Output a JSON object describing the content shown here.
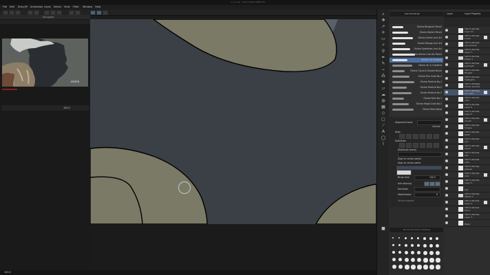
{
  "app": {
    "title": "1_C1.clip - CLIP STUDIO PAINT EX",
    "menu": [
      "File",
      "Edit",
      "Story(P)",
      "Animation",
      "Layer",
      "Select",
      "View",
      "Filter",
      "Window",
      "Help"
    ]
  },
  "left_panel": {
    "navigator_label": "Navigator",
    "zoom_value": "100.0",
    "status_zoom": "100.0"
  },
  "brush_panel": {
    "title": "Sub Tool Brush",
    "brushes": [
      "Okuha Blueprint Pencil",
      "Okuha Sketch Pencil",
      "Okuha Anime Line Art",
      "Okuha Manga Line Art",
      "Okuha Eyelashes Line Art",
      "Okuha Anime Line Art Pencil",
      "Okuha Cel Shading",
      "Okuha Air & Gradient",
      "Okuha Cloud & Smoke Brush",
      "Okuha Fine Dust No.1",
      "Okuha Particle No.1",
      "Okuha Particle No.2",
      "Okuha Particle No.3",
      "Okuha Rain No.1",
      "Okuha Magic Dust No.1",
      "Okuha Real Noise"
    ],
    "selected_index": 6
  },
  "tool_property": {
    "alignment_label": "Alignment basis",
    "alignment_value": "Canvas",
    "align_label": "Align",
    "distribute_label": "Distribute",
    "distribute_evenly": "Distribute evenly",
    "align_to_grid": "Align to vector points",
    "align_to_vector": "Align to vector paths",
    "brush_size_label": "Brush Size",
    "brush_size_value": "100.0",
    "anti_alias_label": "Anti-aliasing",
    "hardness_label": "Hardness",
    "stabilization_label": "Stabilization",
    "stabilization_value": "6",
    "vector_magnet": "Vector magnet"
  },
  "color_panel": {
    "title": "Brush size Vector Shading"
  },
  "layer_panel": {
    "tabs": [
      "Layer",
      "Layer Property"
    ],
    "layers": [
      {
        "mode": "100 % Normal",
        "name": "Layer 21",
        "type": "raster"
      },
      {
        "mode": "100 % Normal",
        "name": "brows",
        "type": "raster"
      },
      {
        "mode": "100 % Normal",
        "name": "eye shadow",
        "type": "raster"
      },
      {
        "mode": "100 % Normal",
        "name": "Layer 7",
        "type": "folder"
      },
      {
        "mode": "100 % Normal",
        "name": "Folder 2",
        "type": "folder"
      },
      {
        "mode": "100 % Normal",
        "name": "backlight",
        "type": "raster"
      },
      {
        "mode": "100 % Normal",
        "name": "fill light",
        "type": "raster"
      },
      {
        "mode": "100 % Normal",
        "name": "highlights",
        "type": "raster"
      },
      {
        "mode": "100 % Multiply",
        "name": "darker shadow",
        "type": "raster"
      },
      {
        "mode": "100 % Multiply",
        "name": "key light",
        "type": "raster"
      },
      {
        "mode": "100 % Normal",
        "name": "color",
        "type": "raster"
      },
      {
        "mode": "100 % Normal",
        "name": "Layer 8",
        "type": "raster"
      },
      {
        "mode": "100 % Normal",
        "name": "Layer 6",
        "type": "raster"
      },
      {
        "mode": "100 % Normal",
        "name": "mouth",
        "type": "raster"
      },
      {
        "mode": "100 % Normal",
        "name": "tongue",
        "type": "raster"
      },
      {
        "mode": "100 % Normal",
        "name": "teeth",
        "type": "raster"
      },
      {
        "mode": "100 % Normal",
        "name": "hair",
        "type": "raster"
      },
      {
        "mode": "100 % Normal",
        "name": "beard",
        "type": "raster"
      },
      {
        "mode": "100 % Normal",
        "name": "skin",
        "type": "raster"
      },
      {
        "mode": "100 % Normal",
        "name": "eyes",
        "type": "raster"
      },
      {
        "mode": "100 % Normal",
        "name": "glasses",
        "type": "raster"
      },
      {
        "mode": "100 % Normal",
        "name": "shirt",
        "type": "raster"
      },
      {
        "mode": "100 % Normal",
        "name": "Layer 9",
        "type": "raster"
      },
      {
        "mode": "",
        "name": "hat",
        "type": "raster"
      },
      {
        "mode": "100 % Normal",
        "name": "Sketch 1",
        "type": "folder"
      },
      {
        "mode": "100 % Normal",
        "name": "Layer 2",
        "type": "raster"
      },
      {
        "mode": "100 % Normal",
        "name": "hat 2",
        "type": "raster"
      },
      {
        "mode": "100 % Normal",
        "name": "Layer 3",
        "type": "raster"
      },
      {
        "mode": "",
        "name": "Paper",
        "type": "paper"
      }
    ],
    "selected_index": 9
  },
  "colors": {
    "canvas_bg": "#3a3f43",
    "shape_fill": "#7a7a66",
    "accent": "#4a6ea0"
  }
}
